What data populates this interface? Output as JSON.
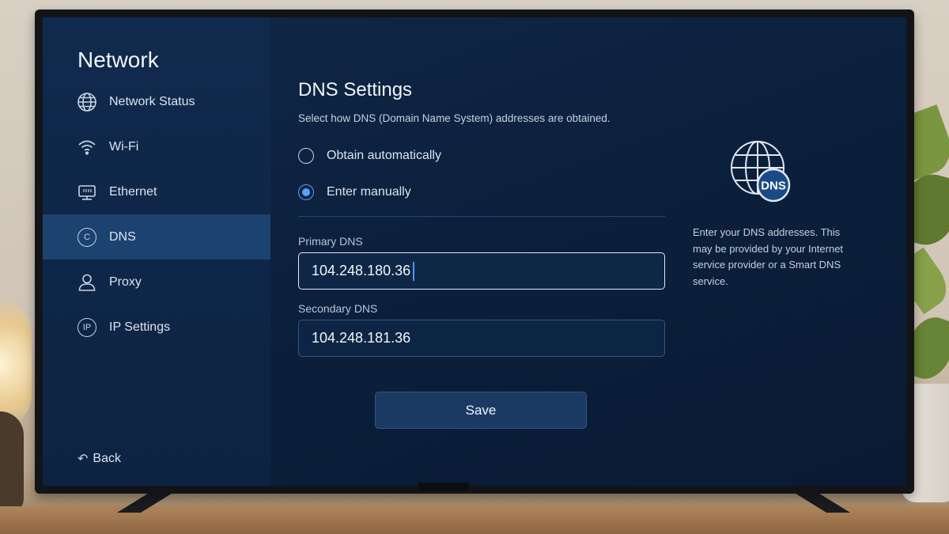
{
  "sidebar": {
    "title": "Network",
    "items": [
      {
        "label": "Network Status",
        "icon": "globe-icon"
      },
      {
        "label": "Wi-Fi",
        "icon": "wifi-icon"
      },
      {
        "label": "Ethernet",
        "icon": "ethernet-icon"
      },
      {
        "label": "DNS",
        "icon": "dns-icon",
        "glyph": "C",
        "active": true
      },
      {
        "label": "Proxy",
        "icon": "user-icon"
      },
      {
        "label": "IP Settings",
        "icon": "ip-icon",
        "glyph": "IP"
      }
    ],
    "back_label": "Back",
    "back_icon": "back-arrow-icon"
  },
  "main": {
    "title": "DNS Settings",
    "description": "Select how DNS (Domain Name System) addresses are obtained.",
    "options": [
      {
        "label": "Obtain automatically",
        "selected": false
      },
      {
        "label": "Enter manually",
        "selected": true
      }
    ],
    "primary_label": "Primary DNS",
    "primary_value": "104.248.180.36",
    "secondary_label": "Secondary DNS",
    "secondary_value": "104.248.181.36",
    "save_label": "Save"
  },
  "info": {
    "icon_badge": "DNS",
    "text": "Enter your DNS addresses. This may be provided by your Internet service provider or a Smart DNS service."
  },
  "colors": {
    "accent": "#5aa0ff",
    "active_nav": "#1c4270",
    "screen_bg": "#0b1f3b"
  }
}
